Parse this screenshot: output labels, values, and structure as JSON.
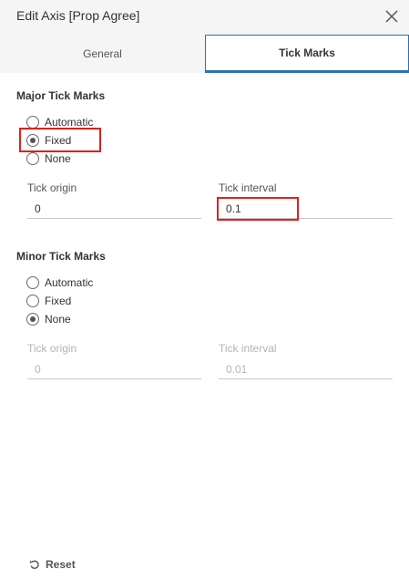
{
  "dialog": {
    "title": "Edit Axis [Prop Agree]"
  },
  "tabs": [
    {
      "label": "General",
      "active": false
    },
    {
      "label": "Tick Marks",
      "active": true
    }
  ],
  "major": {
    "title": "Major Tick Marks",
    "options": [
      "Automatic",
      "Fixed",
      "None"
    ],
    "selected": "Fixed",
    "tick_origin": {
      "label": "Tick origin",
      "value": "0"
    },
    "tick_interval": {
      "label": "Tick interval",
      "value": "0.1"
    }
  },
  "minor": {
    "title": "Minor Tick Marks",
    "options": [
      "Automatic",
      "Fixed",
      "None"
    ],
    "selected": "None",
    "tick_origin": {
      "label": "Tick origin",
      "value": "0"
    },
    "tick_interval": {
      "label": "Tick interval",
      "value": "0.01"
    }
  },
  "footer": {
    "reset_label": "Reset"
  },
  "colors": {
    "accent": "#2f6fb5",
    "highlight": "#e0201b",
    "header_bg": "#f5f5f5"
  }
}
